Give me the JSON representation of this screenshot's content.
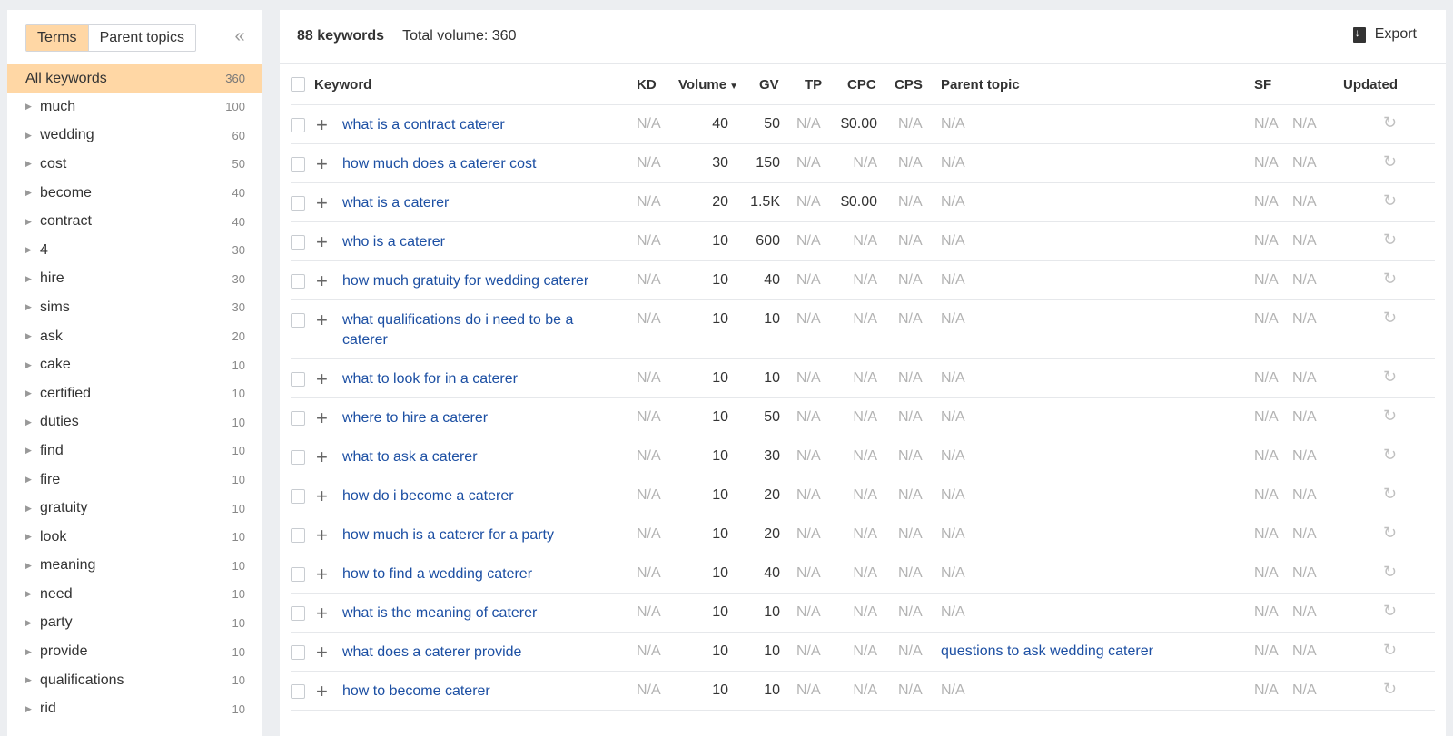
{
  "sidebar": {
    "tabs": [
      "Terms",
      "Parent topics"
    ],
    "collapse_icon": "«",
    "all": {
      "label": "All keywords",
      "count": "360"
    },
    "items": [
      {
        "label": "much",
        "count": "100"
      },
      {
        "label": "wedding",
        "count": "60"
      },
      {
        "label": "cost",
        "count": "50"
      },
      {
        "label": "become",
        "count": "40"
      },
      {
        "label": "contract",
        "count": "40"
      },
      {
        "label": "4",
        "count": "30"
      },
      {
        "label": "hire",
        "count": "30"
      },
      {
        "label": "sims",
        "count": "30"
      },
      {
        "label": "ask",
        "count": "20"
      },
      {
        "label": "cake",
        "count": "10"
      },
      {
        "label": "certified",
        "count": "10"
      },
      {
        "label": "duties",
        "count": "10"
      },
      {
        "label": "find",
        "count": "10"
      },
      {
        "label": "fire",
        "count": "10"
      },
      {
        "label": "gratuity",
        "count": "10"
      },
      {
        "label": "look",
        "count": "10"
      },
      {
        "label": "meaning",
        "count": "10"
      },
      {
        "label": "need",
        "count": "10"
      },
      {
        "label": "party",
        "count": "10"
      },
      {
        "label": "provide",
        "count": "10"
      },
      {
        "label": "qualifications",
        "count": "10"
      },
      {
        "label": "rid",
        "count": "10"
      }
    ]
  },
  "header": {
    "count": "88 keywords",
    "total_volume": "Total volume: 360",
    "export_label": "Export"
  },
  "columns": {
    "keyword": "Keyword",
    "kd": "KD",
    "volume": "Volume",
    "gv": "GV",
    "tp": "TP",
    "cpc": "CPC",
    "cps": "CPS",
    "parent": "Parent topic",
    "sf": "SF",
    "updated": "Updated"
  },
  "rows": [
    {
      "kw": "what is a contract caterer",
      "kd": "N/A",
      "vol": "40",
      "gv": "50",
      "tp": "N/A",
      "cpc": "$0.00",
      "cps": "N/A",
      "parent": "N/A",
      "sf1": "N/A",
      "sf2": "N/A"
    },
    {
      "kw": "how much does a caterer cost",
      "kd": "N/A",
      "vol": "30",
      "gv": "150",
      "tp": "N/A",
      "cpc": "N/A",
      "cps": "N/A",
      "parent": "N/A",
      "sf1": "N/A",
      "sf2": "N/A"
    },
    {
      "kw": "what is a caterer",
      "kd": "N/A",
      "vol": "20",
      "gv": "1.5K",
      "tp": "N/A",
      "cpc": "$0.00",
      "cps": "N/A",
      "parent": "N/A",
      "sf1": "N/A",
      "sf2": "N/A"
    },
    {
      "kw": "who is a caterer",
      "kd": "N/A",
      "vol": "10",
      "gv": "600",
      "tp": "N/A",
      "cpc": "N/A",
      "cps": "N/A",
      "parent": "N/A",
      "sf1": "N/A",
      "sf2": "N/A"
    },
    {
      "kw": "how much gratuity for wedding caterer",
      "kd": "N/A",
      "vol": "10",
      "gv": "40",
      "tp": "N/A",
      "cpc": "N/A",
      "cps": "N/A",
      "parent": "N/A",
      "sf1": "N/A",
      "sf2": "N/A"
    },
    {
      "kw": "what qualifications do i need to be a caterer",
      "kd": "N/A",
      "vol": "10",
      "gv": "10",
      "tp": "N/A",
      "cpc": "N/A",
      "cps": "N/A",
      "parent": "N/A",
      "sf1": "N/A",
      "sf2": "N/A"
    },
    {
      "kw": "what to look for in a caterer",
      "kd": "N/A",
      "vol": "10",
      "gv": "10",
      "tp": "N/A",
      "cpc": "N/A",
      "cps": "N/A",
      "parent": "N/A",
      "sf1": "N/A",
      "sf2": "N/A"
    },
    {
      "kw": "where to hire a caterer",
      "kd": "N/A",
      "vol": "10",
      "gv": "50",
      "tp": "N/A",
      "cpc": "N/A",
      "cps": "N/A",
      "parent": "N/A",
      "sf1": "N/A",
      "sf2": "N/A"
    },
    {
      "kw": "what to ask a caterer",
      "kd": "N/A",
      "vol": "10",
      "gv": "30",
      "tp": "N/A",
      "cpc": "N/A",
      "cps": "N/A",
      "parent": "N/A",
      "sf1": "N/A",
      "sf2": "N/A"
    },
    {
      "kw": "how do i become a caterer",
      "kd": "N/A",
      "vol": "10",
      "gv": "20",
      "tp": "N/A",
      "cpc": "N/A",
      "cps": "N/A",
      "parent": "N/A",
      "sf1": "N/A",
      "sf2": "N/A"
    },
    {
      "kw": "how much is a caterer for a party",
      "kd": "N/A",
      "vol": "10",
      "gv": "20",
      "tp": "N/A",
      "cpc": "N/A",
      "cps": "N/A",
      "parent": "N/A",
      "sf1": "N/A",
      "sf2": "N/A"
    },
    {
      "kw": "how to find a wedding caterer",
      "kd": "N/A",
      "vol": "10",
      "gv": "40",
      "tp": "N/A",
      "cpc": "N/A",
      "cps": "N/A",
      "parent": "N/A",
      "sf1": "N/A",
      "sf2": "N/A"
    },
    {
      "kw": "what is the meaning of caterer",
      "kd": "N/A",
      "vol": "10",
      "gv": "10",
      "tp": "N/A",
      "cpc": "N/A",
      "cps": "N/A",
      "parent": "N/A",
      "sf1": "N/A",
      "sf2": "N/A"
    },
    {
      "kw": "what does a caterer provide",
      "kd": "N/A",
      "vol": "10",
      "gv": "10",
      "tp": "N/A",
      "cpc": "N/A",
      "cps": "N/A",
      "parent": "questions to ask wedding caterer",
      "sf1": "N/A",
      "sf2": "N/A"
    },
    {
      "kw": "how to become caterer",
      "kd": "N/A",
      "vol": "10",
      "gv": "10",
      "tp": "N/A",
      "cpc": "N/A",
      "cps": "N/A",
      "parent": "N/A",
      "sf1": "N/A",
      "sf2": "N/A"
    }
  ]
}
